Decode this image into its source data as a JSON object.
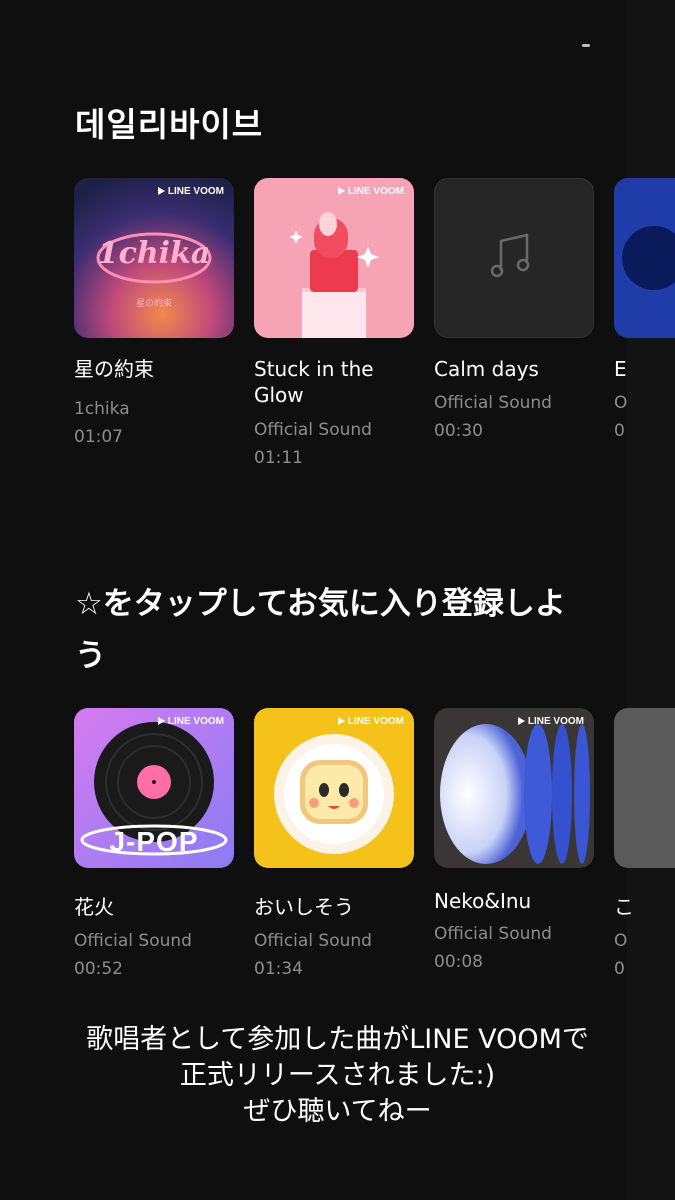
{
  "sections": [
    {
      "title": "데일리바이브",
      "cards": [
        {
          "title": "星の約束",
          "artist": "1chika",
          "duration": "01:07",
          "badge": "LINE VOOM",
          "art_text": "1chika",
          "art_sub": "星の約束",
          "icon": "album-art-1chika"
        },
        {
          "title": "Stuck in the Glow",
          "artist": "Official Sound",
          "duration": "01:11",
          "badge": "LINE VOOM",
          "icon": "album-art-lipstick"
        },
        {
          "title": "Calm days",
          "artist": "Official Sound",
          "duration": "00:30",
          "icon": "music-note-icon"
        },
        {
          "title": "E",
          "artist": "O",
          "duration": "0",
          "icon": "album-art-partial"
        }
      ]
    },
    {
      "title": "☆をタップしてお気に入り登録しよう",
      "cards": [
        {
          "title": "花火",
          "artist": "Official Sound",
          "duration": "00:52",
          "badge": "LINE VOOM",
          "art_text": "J-POP",
          "icon": "album-art-vinyl"
        },
        {
          "title": "おいしそう",
          "artist": "Official Sound",
          "duration": "01:34",
          "badge": "LINE VOOM",
          "icon": "album-art-toast"
        },
        {
          "title": "Neko&Inu",
          "artist": "Official Sound",
          "duration": "00:08",
          "badge": "LINE VOOM",
          "icon": "album-art-ovals"
        },
        {
          "title": "こ",
          "artist": "O",
          "duration": "0",
          "icon": "album-art-partial"
        }
      ]
    }
  ],
  "caption_lines": [
    "歌唱者として参加した曲がLINE VOOMで",
    "正式リリースされました:)",
    "ぜひ聴いてねー"
  ],
  "colors": {
    "background": "#0f0f0f",
    "subtext": "#8d8d8d",
    "accent_pink": "#ff6fa5"
  }
}
